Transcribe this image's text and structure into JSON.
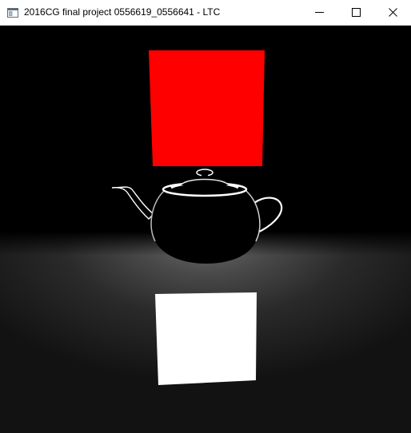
{
  "window": {
    "title": "2016CG final project 0556619_0556641 - LTC",
    "controls": {
      "minimize_icon": "minimize-icon",
      "maximize_icon": "maximize-icon",
      "close_icon": "close-icon"
    }
  },
  "scene": {
    "background_color": "#000000",
    "area_light_color": "#ff0000",
    "reflection_color": "#ffffff",
    "floor_highlight_color": "#5a5a5a",
    "objects": [
      "teapot",
      "area-light",
      "floor-reflection"
    ]
  }
}
